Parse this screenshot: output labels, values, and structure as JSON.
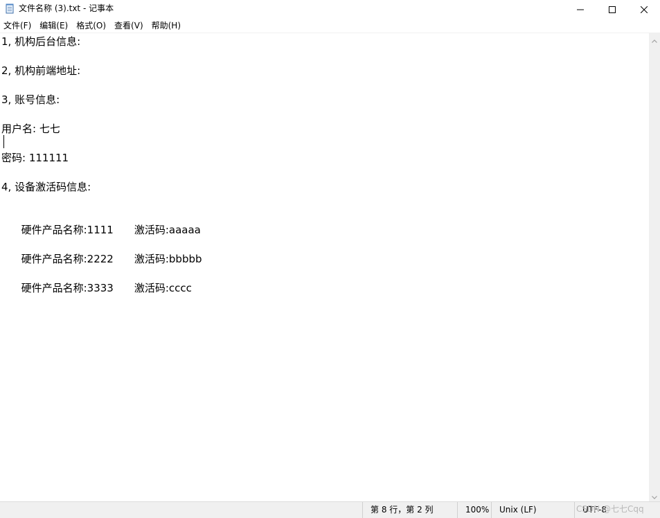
{
  "window": {
    "title": "文件名称 (3).txt - 记事本",
    "controls": {
      "minimize": "minimize",
      "maximize": "maximize",
      "close": "close"
    }
  },
  "menu": [
    {
      "label": "文件(F)"
    },
    {
      "label": "编辑(E)"
    },
    {
      "label": "格式(O)"
    },
    {
      "label": "查看(V)"
    },
    {
      "label": "帮助(H)"
    }
  ],
  "document": {
    "lines": [
      "1, 机构后台信息:",
      "",
      "2, 机构前端地址:",
      "",
      "3, 账号信息:",
      "",
      "用户名: 七七",
      "",
      "密码: 111111",
      "",
      "4, 设备激活码信息:",
      "",
      "硬件产品名称:1111",
      "",
      "硬件产品名称:2222",
      "",
      "硬件产品名称:3333"
    ],
    "activation": {
      "row1_label": "激活码:aaaaa",
      "row2_label": "激活码:bbbbb",
      "row3_label": "激活码:cccc"
    }
  },
  "status": {
    "position": "第 8 行，第 2 列",
    "zoom": "100%",
    "line_ending": "Unix (LF)",
    "encoding": "UTF-8"
  },
  "watermark": "CSDN @七七Cqq",
  "colors": {
    "background": "#ffffff",
    "statusbar": "#f0f0f0",
    "text": "#000000",
    "watermark": "#b8b8b8"
  },
  "icons": {
    "app": "notepad-icon",
    "minimize": "minimize-icon",
    "maximize": "maximize-icon",
    "close": "close-icon",
    "scroll_up": "chevron-up-icon",
    "scroll_down": "chevron-down-icon"
  }
}
